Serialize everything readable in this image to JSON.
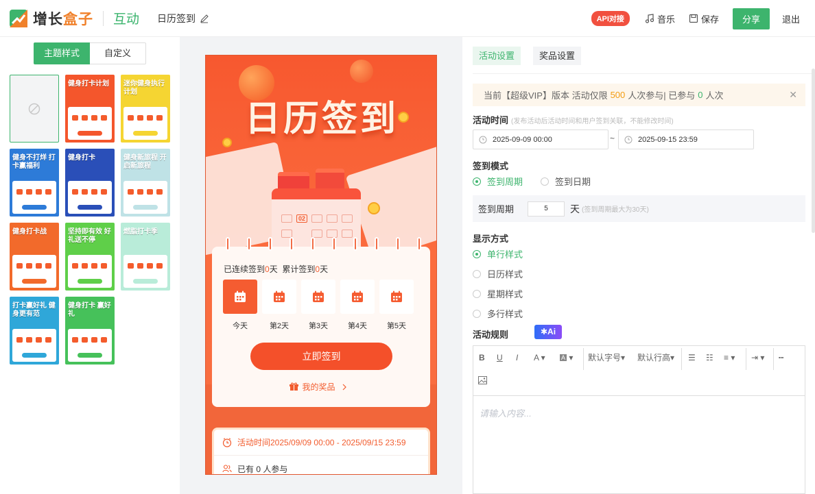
{
  "header": {
    "logo_text_a": "增长",
    "logo_text_b": "盒子",
    "module": "互动",
    "activity_name": "日历签到",
    "api_badge": "API对接",
    "music": "音乐",
    "save": "保存",
    "share": "分享",
    "logout": "退出"
  },
  "left": {
    "tab_theme": "主题样式",
    "tab_custom": "自定义",
    "themes": [
      {
        "title": "",
        "none": true
      },
      {
        "title": "健身打卡计划",
        "bg": "#f4562c"
      },
      {
        "title": "迷你健身执行计划",
        "bg": "#f5d532"
      },
      {
        "title": "健身不打烊 打卡赢福利",
        "bg": "#2d7bd8"
      },
      {
        "title": "健身打卡",
        "bg": "#2a4fb8"
      },
      {
        "title": "健身新旅程 开启新旅程",
        "bg": "#bfe2e6"
      },
      {
        "title": "健身打卡战",
        "bg": "#f26a2b"
      },
      {
        "title": "坚持即有效 好礼送不停",
        "bg": "#5fcf49"
      },
      {
        "title": "燃脂打卡季",
        "bg": "#b9ecd9"
      },
      {
        "title": "打卡赢好礼 健身更有范",
        "bg": "#2fa7d9"
      },
      {
        "title": "健身打卡 赢好礼",
        "bg": "#46c15a"
      }
    ]
  },
  "preview": {
    "hero_title": "日历签到",
    "calendar_day": "02",
    "streak_prefix": "已连续签到",
    "streak_days": "0",
    "streak_unit": "天",
    "total_prefix": "累计签到",
    "total_days": "0",
    "total_unit": "天",
    "days": [
      "今天",
      "第2天",
      "第3天",
      "第4天",
      "第5天"
    ],
    "checkin_button": "立即签到",
    "my_prizes": "我的奖品",
    "activity_time": "活动时间2025/09/09 00:00 - 2025/09/15 23:59",
    "participants_prefix": "已有",
    "participants_count": "0",
    "participants_suffix": "人参与"
  },
  "settings": {
    "tab_activity": "活动设置",
    "tab_prize": "奖品设置",
    "notice_a": "当前【超级VIP】版本 活动仅限",
    "notice_limit": "500",
    "notice_b": "人次参与| 已参与",
    "notice_used": "0",
    "notice_c": "人次",
    "time_label": "活动时间",
    "time_hint": "(发布活动后活动时间和用户签到关联，不能修改时间)",
    "start_time": "2025-09-09 00:00",
    "end_time": "2025-09-15 23:59",
    "tilde": "~",
    "mode_label": "签到模式",
    "mode_period": "签到周期",
    "mode_date": "签到日期",
    "period_label": "签到周期",
    "period_value": "5",
    "period_unit": "天",
    "period_hint": "(签到周期最大为30天)",
    "display_label": "显示方式",
    "display_options": [
      "单行样式",
      "日历样式",
      "星期样式",
      "多行样式"
    ],
    "rules_label": "活动规则",
    "ai_badge": "Ai",
    "font_size": "默认字号",
    "line_height": "默认行高",
    "editor_placeholder": "请输入内容..."
  },
  "colors": {
    "brand_green": "#3db46d",
    "accent_orange": "#f4502a",
    "api_red": "#f1503f"
  }
}
